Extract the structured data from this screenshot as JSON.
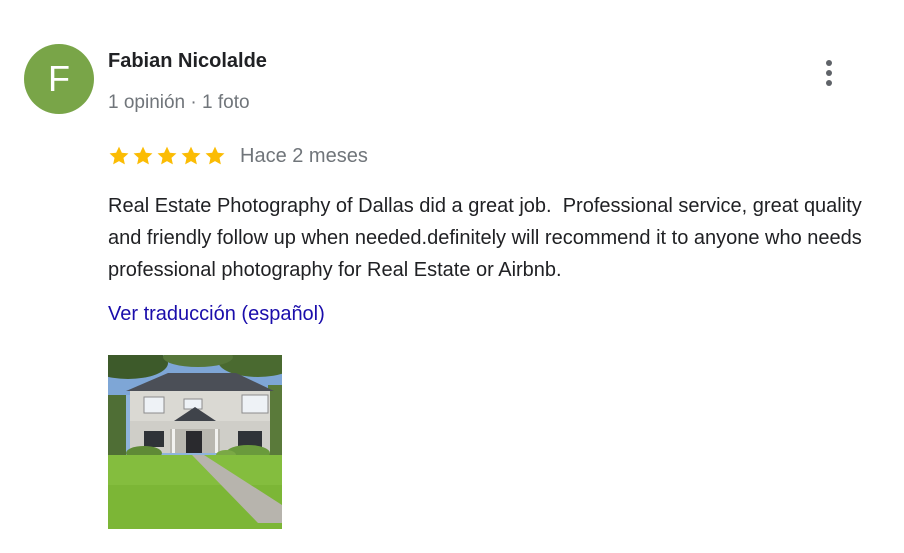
{
  "reviewer": {
    "initial": "F",
    "name": "Fabian Nicolalde",
    "meta": "1 opinión · 1 foto",
    "avatar_color": "#79a548"
  },
  "review": {
    "rating": 5,
    "max_rating": 5,
    "star_color": "#fbbc04",
    "date": "Hace 2 meses",
    "text": "Real Estate Photography of Dallas did a great job.  Professional service, great quality and friendly follow up when needed.definitely will recommend it to anyone who needs professional photography for Real Estate or Airbnb.",
    "translate_label": "Ver traducción (español)",
    "link_color": "#1a0dab"
  },
  "icons": {
    "more": "more-vert-icon",
    "star": "star-icon"
  }
}
